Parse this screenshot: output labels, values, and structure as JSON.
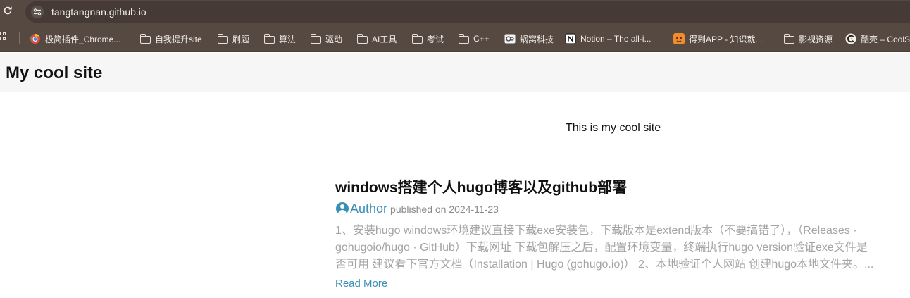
{
  "browser": {
    "url": "tangtangnan.github.io"
  },
  "bookmarks": [
    {
      "label": "极简插件_Chrome...",
      "icon": "chrome-store-icon",
      "color": "#e34c3c"
    },
    {
      "label": "自我提升site",
      "icon": "folder-icon"
    },
    {
      "label": "刷题",
      "icon": "folder-icon"
    },
    {
      "label": "算法",
      "icon": "folder-icon"
    },
    {
      "label": "驱动",
      "icon": "folder-icon"
    },
    {
      "label": "AI工具",
      "icon": "folder-icon"
    },
    {
      "label": "考试",
      "icon": "folder-icon"
    },
    {
      "label": "C++",
      "icon": "folder-icon"
    },
    {
      "label": "蜗窝科技",
      "icon": "wowotech-icon"
    },
    {
      "label": "Notion – The all-i...",
      "icon": "notion-icon"
    },
    {
      "label": "得到APP - 知识就...",
      "icon": "dedao-icon",
      "color": "#f08c2c"
    },
    {
      "label": "影视资源",
      "icon": "folder-icon"
    },
    {
      "label": "酷壳 – CoolS",
      "icon": "coolshell-icon"
    }
  ],
  "site": {
    "title": "My cool site",
    "tagline": "This is my cool site"
  },
  "post": {
    "title": "windows搭建个人hugo博客以及github部署",
    "author": "Author",
    "published": "published on 2024-11-23",
    "excerpt_lines": [
      "1、安装hugo windows环境建议直接下载exe安装包，下载版本是extend版本（不要搞错了），（Releases ·",
      "gohugoio/hugo · GitHub）下载网址 下载包解压之后，配置环境变量，终端执行hugo version验证exe文件是",
      "否可用 建议看下官方文档（Installation | Hugo (gohugo.io)） 2、本地验证个人网站 创建hugo本地文件夹。..."
    ],
    "read_more": "Read More"
  },
  "colors": {
    "chrome_bg": "#554942",
    "link": "#3a8fb4"
  }
}
